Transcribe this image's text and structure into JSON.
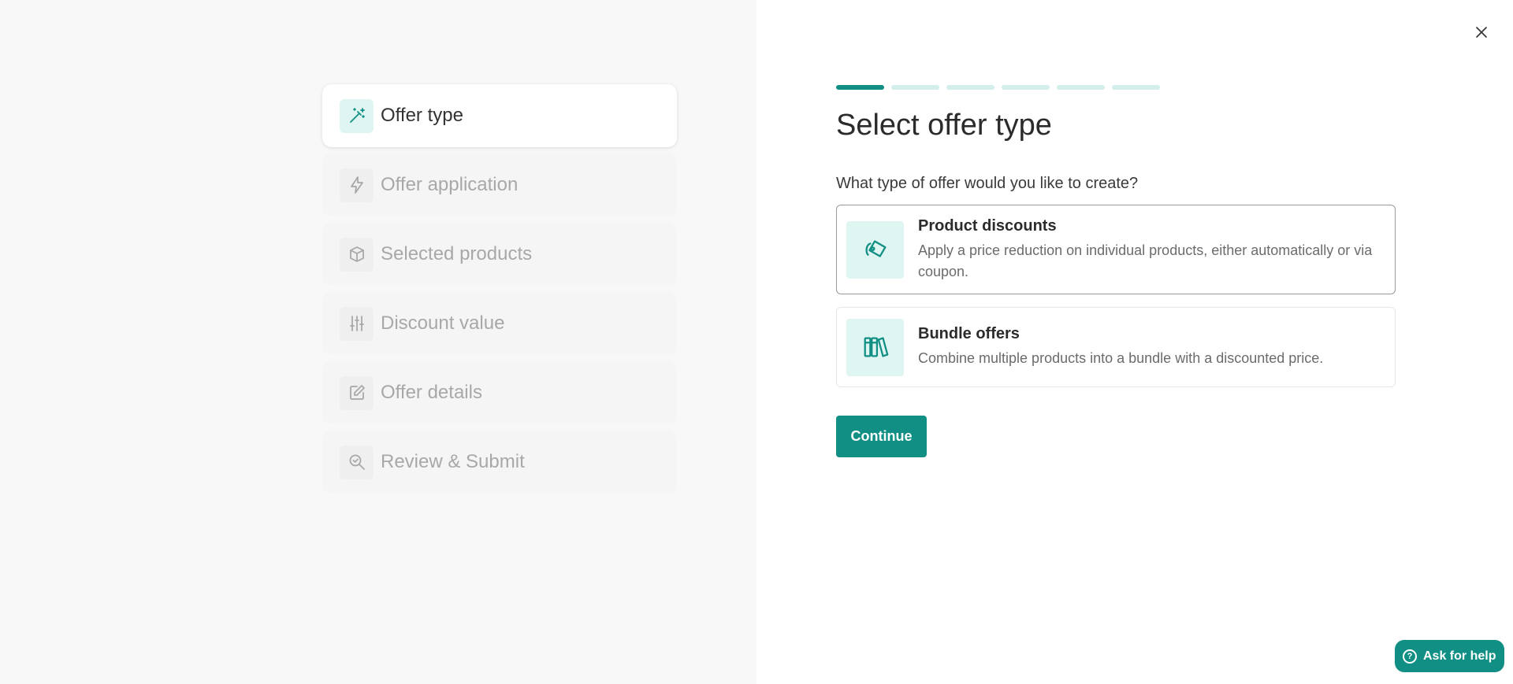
{
  "steps": [
    {
      "label": "Offer type",
      "icon": "magic-wand-icon",
      "active": true
    },
    {
      "label": "Offer application",
      "icon": "lightning-icon",
      "active": false
    },
    {
      "label": "Selected products",
      "icon": "box-icon",
      "active": false
    },
    {
      "label": "Discount value",
      "icon": "sliders-icon",
      "active": false
    },
    {
      "label": "Offer details",
      "icon": "edit-icon",
      "active": false
    },
    {
      "label": "Review & Submit",
      "icon": "search-check-icon",
      "active": false
    }
  ],
  "progress": {
    "total_steps": 6,
    "current_step": 1
  },
  "main": {
    "title": "Select offer type",
    "question": "What type of offer would you like to create?",
    "options": [
      {
        "title": "Product discounts",
        "description": "Apply a price reduction on individual products, either automatically or via coupon.",
        "icon": "tag-icon",
        "selected": true
      },
      {
        "title": "Bundle offers",
        "description": "Combine multiple products into a bundle with a discounted price.",
        "icon": "books-icon",
        "selected": false
      }
    ],
    "continue_label": "Continue"
  },
  "help": {
    "label": "Ask for help"
  },
  "colors": {
    "accent": "#128f84",
    "accent_light": "#dff5f2",
    "progress_inactive": "#d3eeeb"
  }
}
